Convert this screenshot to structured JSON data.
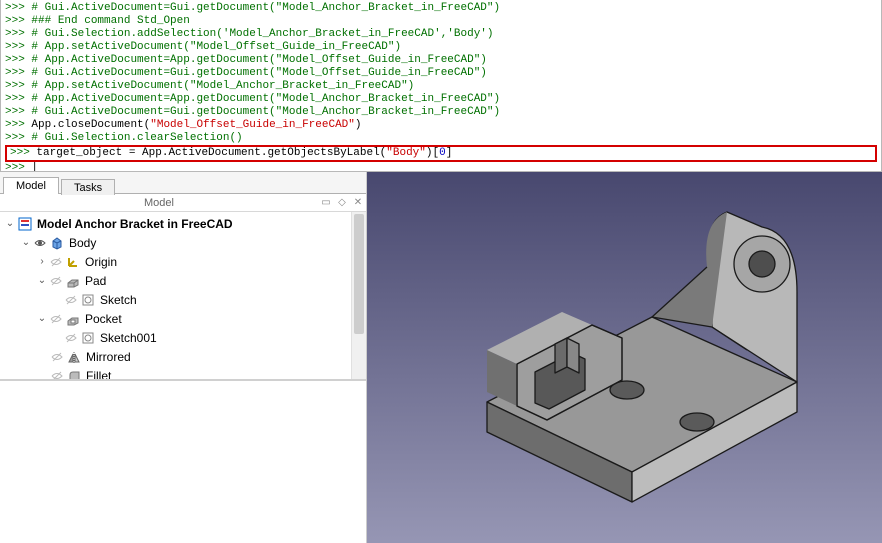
{
  "console": {
    "lines": [
      {
        "type": "comment",
        "text": "# Gui.ActiveDocument=Gui.getDocument(\"Model_Anchor_Bracket_in_FreeCAD\")"
      },
      {
        "type": "comment",
        "text": "### End command Std_Open"
      },
      {
        "type": "comment",
        "text": "# Gui.Selection.addSelection('Model_Anchor_Bracket_in_FreeCAD','Body')"
      },
      {
        "type": "comment",
        "text": "# App.setActiveDocument(\"Model_Offset_Guide_in_FreeCAD\")"
      },
      {
        "type": "comment",
        "text": "# App.ActiveDocument=App.getDocument(\"Model_Offset_Guide_in_FreeCAD\")"
      },
      {
        "type": "comment",
        "text": "# Gui.ActiveDocument=Gui.getDocument(\"Model_Offset_Guide_in_FreeCAD\")"
      },
      {
        "type": "comment",
        "text": "# App.setActiveDocument(\"Model_Anchor_Bracket_in_FreeCAD\")"
      },
      {
        "type": "comment",
        "text": "# App.ActiveDocument=App.getDocument(\"Model_Anchor_Bracket_in_FreeCAD\")"
      },
      {
        "type": "comment",
        "text": "# Gui.ActiveDocument=Gui.getDocument(\"Model_Anchor_Bracket_in_FreeCAD\")"
      },
      {
        "type": "close",
        "prefix": "App.closeDocument(",
        "str": "\"Model_Offset_Guide_in_FreeCAD\"",
        "suffix": ")"
      },
      {
        "type": "comment",
        "text": "# Gui.Selection.clearSelection()"
      }
    ],
    "highlight": {
      "lhs": "target_object = App.ActiveDocument.getObjectsByLabel(",
      "str": "\"Body\"",
      "mid": ")[",
      "num": "0",
      "end": "]"
    },
    "prompt": ">>>"
  },
  "tabs": {
    "model": "Model",
    "tasks": "Tasks"
  },
  "panel": {
    "title": "Model",
    "float_icon": "❐",
    "pin_icon": "⌀",
    "close_icon": "✕"
  },
  "tree": {
    "doc": {
      "label": "Model Anchor Bracket in FreeCAD"
    },
    "body": {
      "label": "Body"
    },
    "origin": {
      "label": "Origin"
    },
    "pad": {
      "label": "Pad"
    },
    "sketch": {
      "label": "Sketch"
    },
    "pocket": {
      "label": "Pocket"
    },
    "sketch001": {
      "label": "Sketch001"
    },
    "mirrored": {
      "label": "Mirrored"
    },
    "fillet": {
      "label": "Fillet"
    }
  }
}
